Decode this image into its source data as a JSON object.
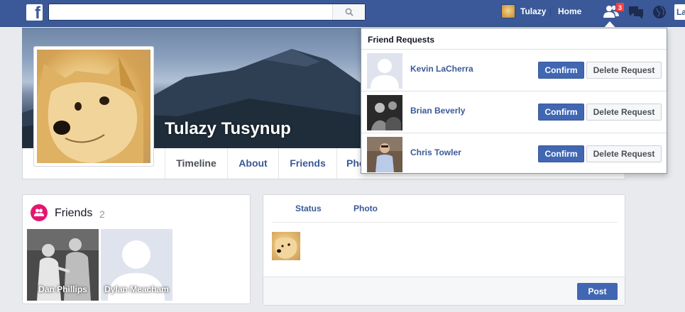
{
  "topbar": {
    "logo_letter": "f",
    "search_placeholder": "",
    "user_name": "Tulazy",
    "home_label": "Home",
    "friend_requests_count": "3",
    "right_tab_label": "La"
  },
  "profile": {
    "name": "Tulazy Tusynup",
    "tabs": [
      {
        "label": "Timeline"
      },
      {
        "label": "About"
      },
      {
        "label": "Friends"
      },
      {
        "label": "Pho"
      }
    ]
  },
  "friends_card": {
    "title": "Friends",
    "count": "2",
    "friends": [
      {
        "name": "Dan Phillips"
      },
      {
        "name": "Dylan Meacham"
      }
    ]
  },
  "composer": {
    "tabs": [
      {
        "label": "Status"
      },
      {
        "label": "Photo"
      }
    ],
    "post_label": "Post"
  },
  "friend_requests": {
    "title": "Friend Requests",
    "confirm_label": "Confirm",
    "delete_label": "Delete Request",
    "requests": [
      {
        "name": "Kevin LaCherra",
        "photo": "default-silhouette"
      },
      {
        "name": "Brian Beverly",
        "photo": "bw-photo"
      },
      {
        "name": "Chris Towler",
        "photo": "color-photo"
      }
    ]
  },
  "colors": {
    "topbar": "#3b5998",
    "link": "#3b5998",
    "confirm_button": "#4267b2",
    "badge": "#fa3e3e",
    "friends_icon": "#e4166f",
    "background": "#e9eaed"
  }
}
